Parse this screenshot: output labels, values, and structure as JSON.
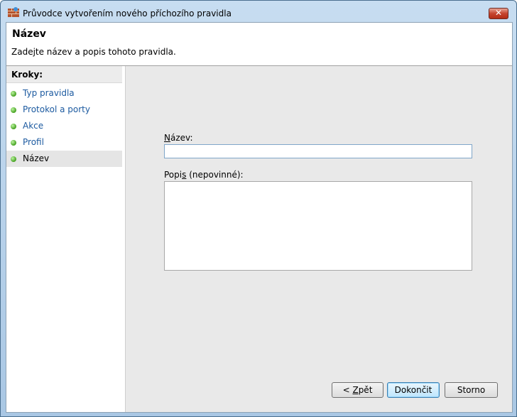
{
  "window": {
    "title": "Průvodce vytvořením nového příchozího pravidla",
    "close_symbol": "✕"
  },
  "header": {
    "title": "Název",
    "subtitle": "Zadejte název a popis tohoto pravidla."
  },
  "steps": {
    "title": "Kroky:",
    "items": [
      {
        "label": "Typ pravidla"
      },
      {
        "label": "Protokol a porty"
      },
      {
        "label": "Akce"
      },
      {
        "label": "Profil"
      },
      {
        "label": "Název"
      }
    ]
  },
  "form": {
    "name_label_mnemonic": "N",
    "name_label_rest": "ázev:",
    "name_value": "",
    "desc_label_pre": "Popi",
    "desc_label_mnemonic": "s",
    "desc_label_post": " (nepovinné):",
    "desc_value": ""
  },
  "buttons": {
    "back_pre": "< ",
    "back_mnemonic": "Z",
    "back_post": "pět",
    "finish": "Dokončit",
    "cancel": "Storno"
  },
  "colors": {
    "accent_link": "#1c5aa0",
    "step_dot": "#44a020",
    "close_button": "#c6452f"
  }
}
